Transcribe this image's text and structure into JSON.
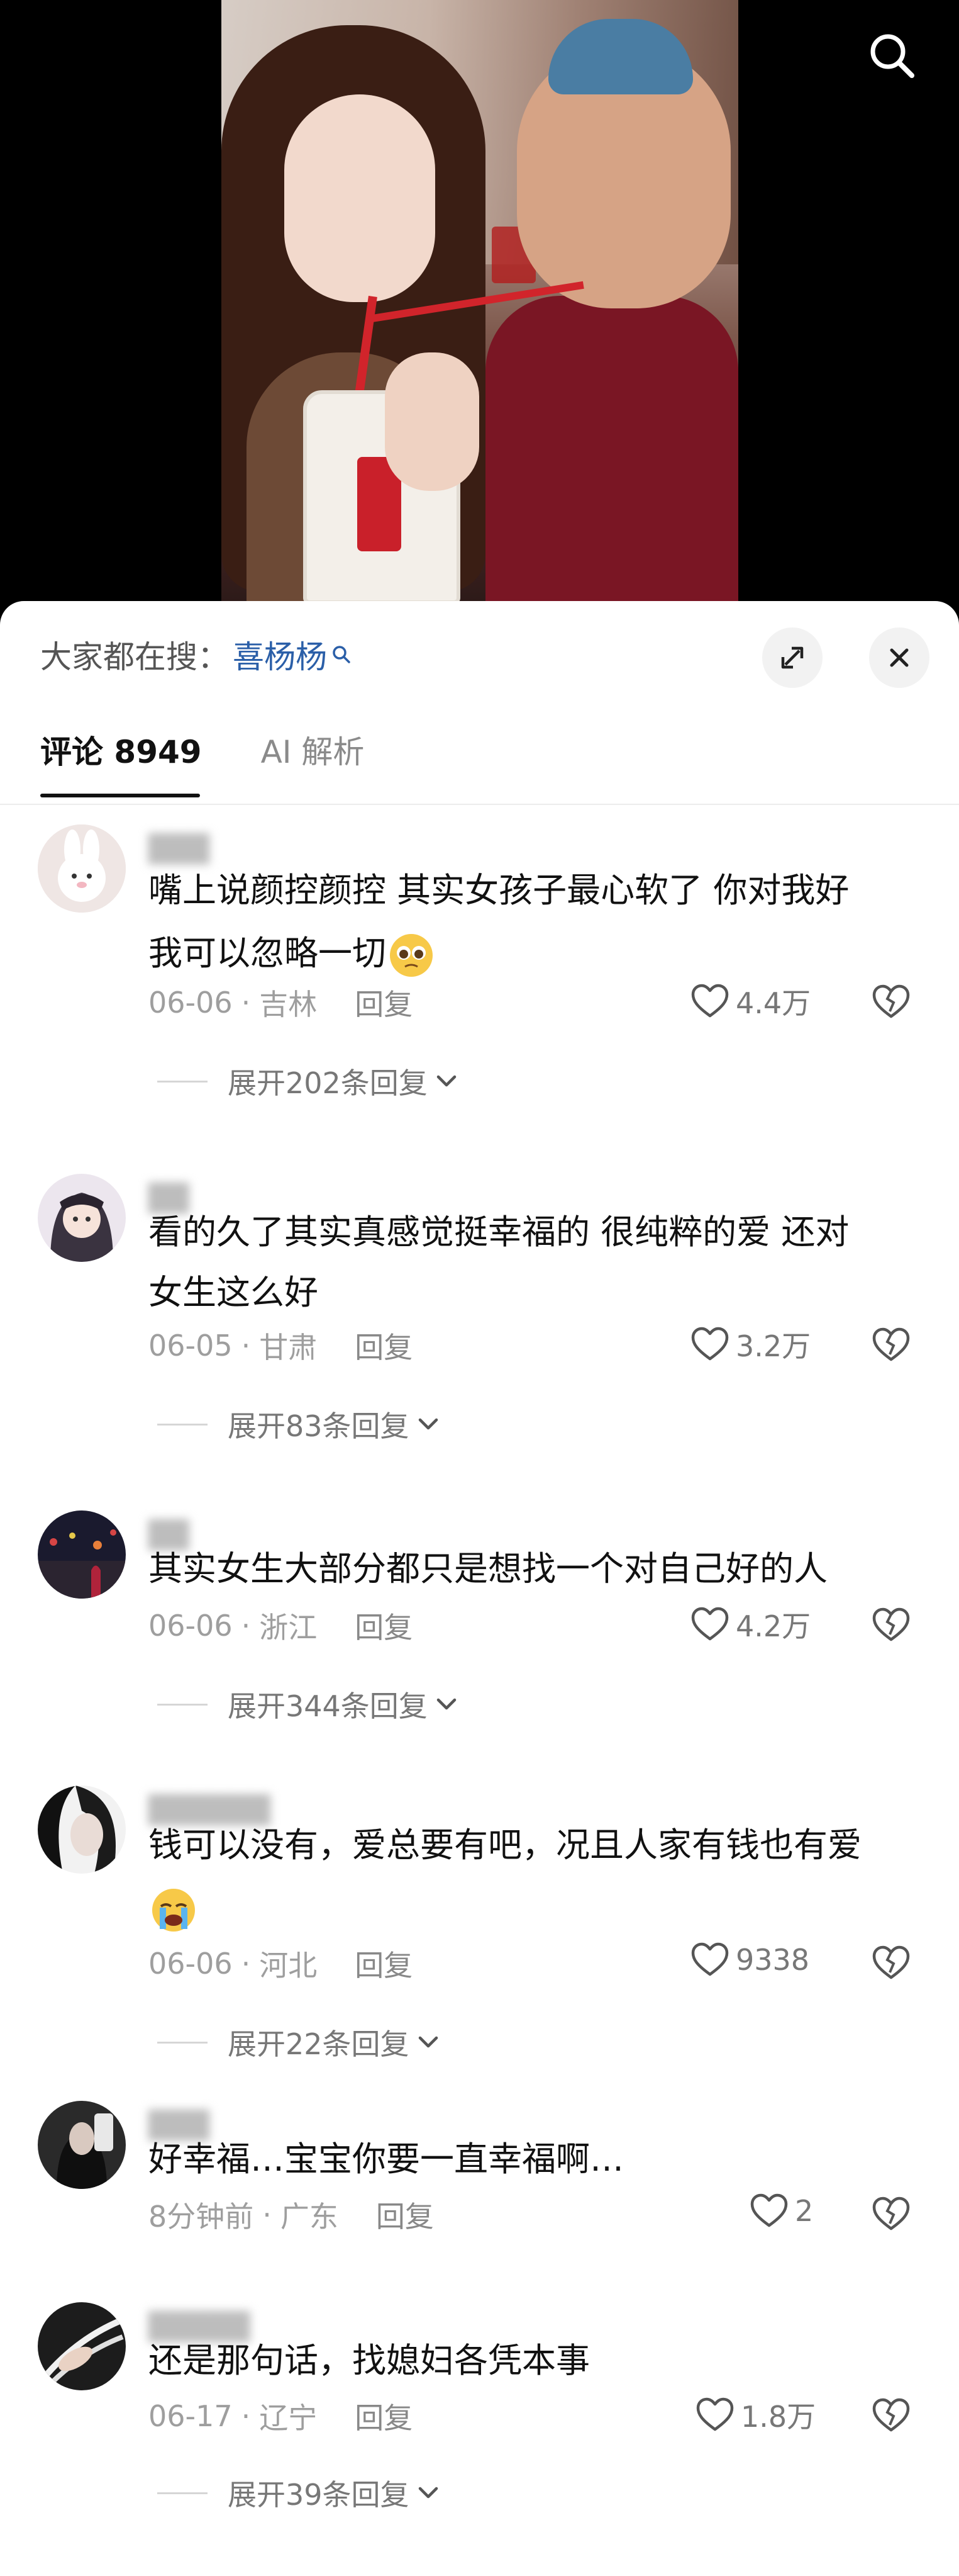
{
  "search_bar": {
    "prefix": "大家都在搜：",
    "term": "喜杨杨"
  },
  "tabs": [
    {
      "label": "评论 8949",
      "active": true
    },
    {
      "label": "AI 解析",
      "active": false
    }
  ],
  "comments": [
    {
      "text_line1": "嘴上说颜控颜控 其实女孩子最心软了 你对我好",
      "text_line2": "我可以忽略一切",
      "date": "06-06",
      "location": "吉林",
      "reply_label": "回复",
      "likes": "4.4万",
      "expand_label": "展开202条回复"
    },
    {
      "text_line1": "看的久了其实真感觉挺幸福的 很纯粹的爱 还对",
      "text_line2": "女生这么好",
      "date": "06-05",
      "location": "甘肃",
      "reply_label": "回复",
      "likes": "3.2万",
      "expand_label": "展开83条回复"
    },
    {
      "text_line1": "其实女生大部分都只是想找一个对自己好的人",
      "text_line2": "",
      "date": "06-06",
      "location": "浙江",
      "reply_label": "回复",
      "likes": "4.2万",
      "expand_label": "展开344条回复"
    },
    {
      "text_line1": "钱可以没有，爱总要有吧，况且人家有钱也有爱",
      "text_line2": "",
      "date": "06-06",
      "location": "河北",
      "reply_label": "回复",
      "likes": "9338",
      "expand_label": "展开22条回复"
    },
    {
      "text_line1": "好幸福…宝宝你要一直幸福啊…",
      "text_line2": "",
      "date": "8分钟前",
      "location": "广东",
      "reply_label": "回复",
      "likes": "2",
      "expand_label": ""
    },
    {
      "text_line1": "还是那句话，找媳妇各凭本事",
      "text_line2": "",
      "date": "06-17",
      "location": "辽宁",
      "reply_label": "回复",
      "likes": "1.8万",
      "expand_label": "展开39条回复"
    }
  ],
  "colors": {
    "accent_link": "#2b5fa8",
    "text": "#111111",
    "muted": "#9e9e9e"
  }
}
